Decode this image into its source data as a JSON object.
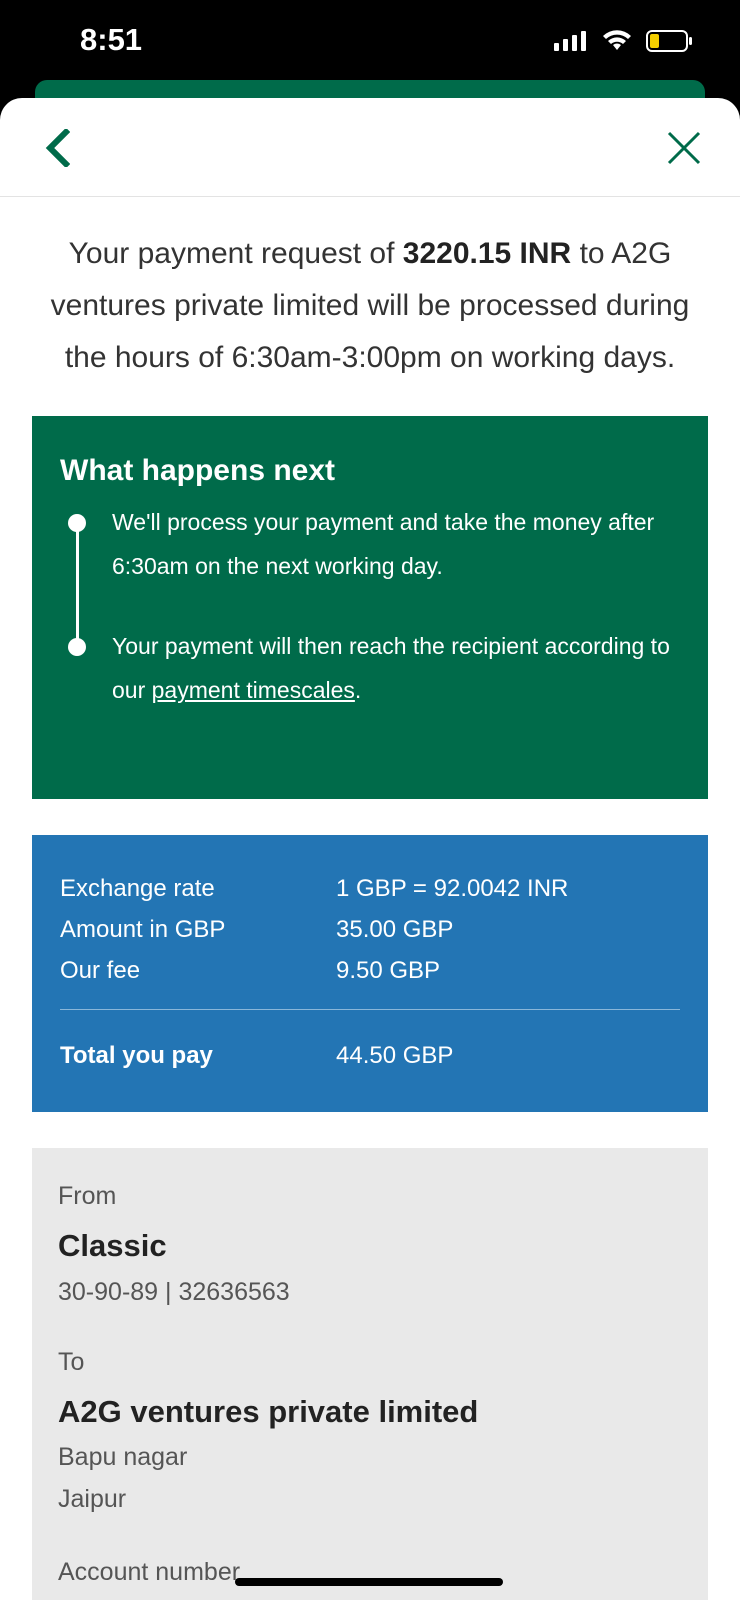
{
  "status_bar": {
    "time": "8:51",
    "icons": [
      "cellular-signal-icon",
      "wifi-icon",
      "battery-icon"
    ]
  },
  "header": {
    "back_icon": "chevron-left-icon",
    "close_icon": "close-icon"
  },
  "intro": {
    "prefix": "Your payment request of ",
    "amount": "3220.15 INR",
    "suffix": " to A2G ventures private limited will be processed during the hours of 6:30am-3:00pm on working days."
  },
  "what_next": {
    "title": "What happens next",
    "step1": "We'll process your payment and take the money after 6:30am on the next working day.",
    "step2_prefix": "Your payment will then reach the recipient according to our ",
    "step2_link": "payment timescales",
    "step2_suffix": "."
  },
  "rates": {
    "rows": [
      {
        "label": "Exchange rate",
        "value": "1 GBP = 92.0042 INR"
      },
      {
        "label": "Amount in GBP",
        "value": "35.00 GBP"
      },
      {
        "label": "Our fee",
        "value": "9.50 GBP"
      }
    ],
    "total_label": "Total you pay",
    "total_value": "44.50 GBP"
  },
  "details": {
    "from_label": "From",
    "from_name": "Classic",
    "from_account": "30-90-89 | 32636563",
    "to_label": "To",
    "to_name": "A2G ventures private limited",
    "to_line1": "Bapu nagar",
    "to_line2": "Jaipur",
    "account_label": "Account number"
  },
  "colors": {
    "brand_green": "#006b4a",
    "info_blue": "#2375b4",
    "details_grey": "#e9e9e9"
  }
}
